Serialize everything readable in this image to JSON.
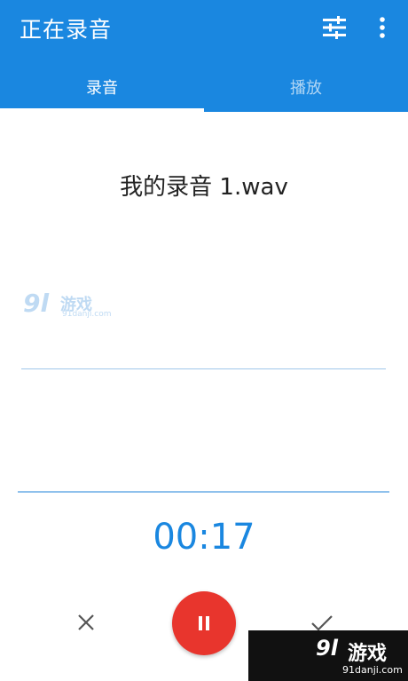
{
  "app_bar": {
    "title": "正在录音",
    "background": "#1a87e0",
    "actions": {
      "tune_icon": "tune-icon",
      "more_icon": "more-vert-icon"
    }
  },
  "tabs": [
    {
      "label": "录音",
      "selected": true
    },
    {
      "label": "播放",
      "selected": false
    }
  ],
  "recording": {
    "file_name": "我的录音 1.wav",
    "elapsed": "00:17"
  },
  "controls": {
    "cancel_icon": "close-icon",
    "pause_icon": "pause-icon",
    "confirm_icon": "check-icon",
    "pause_color": "#e8352d"
  },
  "watermarks": {
    "center": {
      "logo": "9l",
      "game": "游戏",
      "url": "91danji.com"
    },
    "corner": {
      "logo": "9l",
      "game": "游戏",
      "url": "91danji.com"
    }
  }
}
